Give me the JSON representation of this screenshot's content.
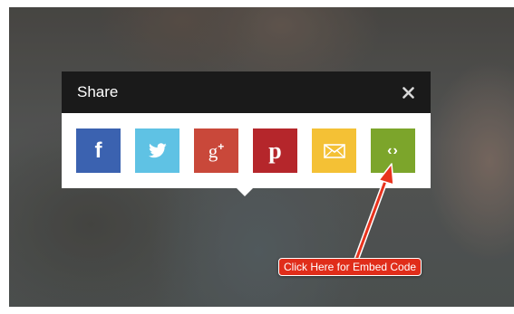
{
  "share_dialog": {
    "title": "Share",
    "close_glyph": "✕",
    "buttons": [
      {
        "name": "facebook",
        "icon": "facebook-icon",
        "glyph": "f",
        "color": "#3b62b0"
      },
      {
        "name": "twitter",
        "icon": "twitter-icon",
        "glyph": "bird",
        "color": "#5fc2e4"
      },
      {
        "name": "google-plus",
        "icon": "google-plus-icon",
        "glyph": "g+",
        "color": "#c9483a"
      },
      {
        "name": "pinterest",
        "icon": "pinterest-icon",
        "glyph": "p",
        "color": "#b5262b"
      },
      {
        "name": "email",
        "icon": "envelope-icon",
        "glyph": "envelope",
        "color": "#f4c135"
      },
      {
        "name": "embed",
        "icon": "code-icon",
        "glyph": "‹›",
        "color": "#7ca52b"
      }
    ]
  },
  "annotation": {
    "callout_text": "Click Here for Embed Code",
    "arrow_color": "#e8321d"
  }
}
